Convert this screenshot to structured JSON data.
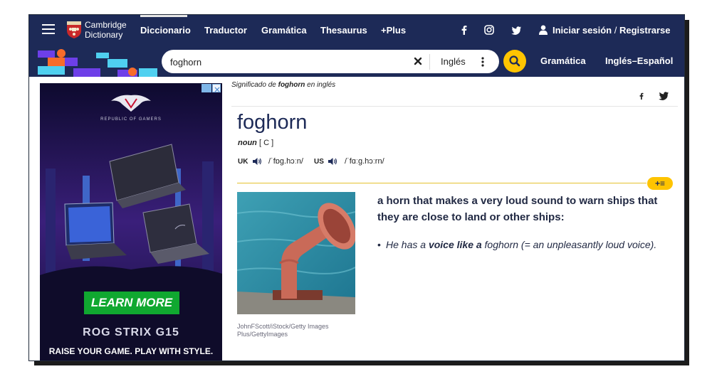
{
  "brand": {
    "line1": "Cambridge",
    "line2": "Dictionary"
  },
  "nav": [
    "Diccionario",
    "Traductor",
    "Gramática",
    "Thesaurus",
    "+Plus"
  ],
  "auth": {
    "login": "Iniciar sesión",
    "sep": "/",
    "register": "Registrarse"
  },
  "social_icons": [
    "facebook-icon",
    "instagram-icon",
    "twitter-icon"
  ],
  "search": {
    "value": "foghorn",
    "language": "Inglés"
  },
  "nav2": [
    "Gramática",
    "Inglés–Español"
  ],
  "ad": {
    "brand": "REPUBLIC OF GAMERS",
    "cta": "LEARN MORE",
    "product": "ROG STRIX G15",
    "tagline": "RAISE YOUR GAME. PLAY WITH STYLE."
  },
  "entry": {
    "breadcrumb_pre": "Significado de",
    "breadcrumb_word": "foghorn",
    "breadcrumb_post": "en inglés",
    "headword": "foghorn",
    "pos": "noun",
    "grammar": "[ C ]",
    "uk_label": "UK",
    "uk_ipa": "/ˈfɒɡ.hɔːn/",
    "us_label": "US",
    "us_ipa": "/ˈfɑːɡ.hɔːrn/",
    "add_label": "+≡",
    "definition": "a horn that makes a very loud sound to warn ships that they are close to land or other ships:",
    "example": {
      "pre": "He has a",
      "bold": "voice like a",
      "word": "foghorn",
      "gloss": "(= an unpleasantly loud voice)."
    },
    "image_credit_line1": "JohnFScott/iStock/Getty Images",
    "image_credit_line2": "Plus/GettyImages"
  },
  "colors": {
    "header": "#1d2a57",
    "accent": "#fec400",
    "ad_bg": "#1a1650"
  }
}
